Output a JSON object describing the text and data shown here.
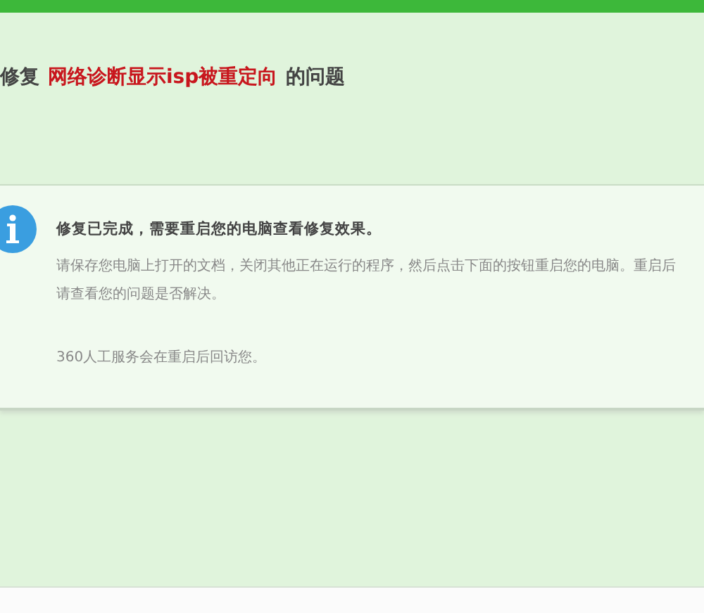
{
  "heading": {
    "prefix": "修复",
    "highlight": "网络诊断显示isp被重定向",
    "suffix": "的问题"
  },
  "notice": {
    "title": "修复已完成，需要重启您的电脑查看修复效果。",
    "body": "请保存您电脑上打开的文档，关闭其他正在运行的程序，然后点击下面的按钮重启您的电脑。重启后请查看您的问题是否解决。",
    "footnote": "360人工服务会在重启后回访您。"
  }
}
